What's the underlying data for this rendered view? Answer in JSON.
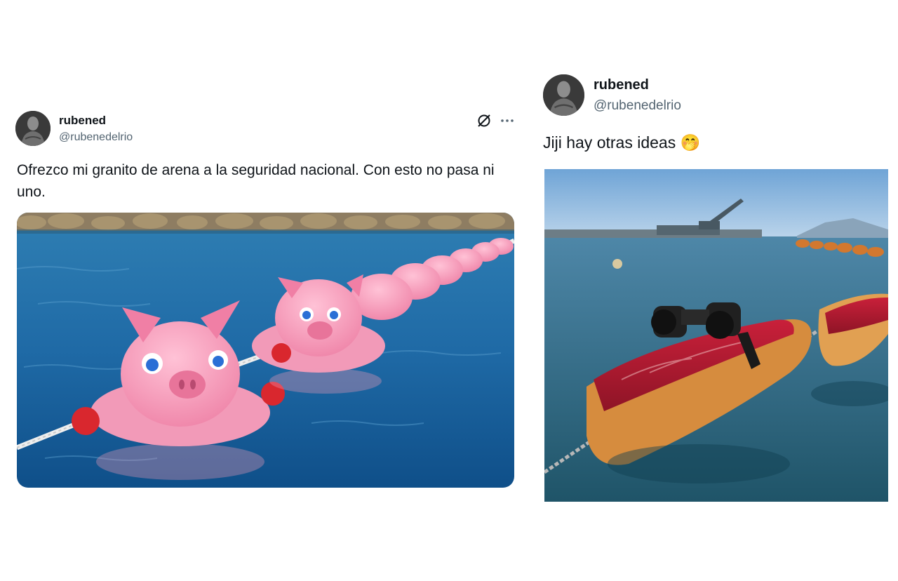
{
  "tweet_left": {
    "display_name": "rubened",
    "handle": "@rubenedelrio",
    "text": "Ofrezco mi granito de arena a la seguridad nacional. Con esto no pasa ni uno.",
    "icons": [
      "grok-icon",
      "more-options-icon"
    ],
    "media": "pig-buoys-photo"
  },
  "tweet_right": {
    "display_name": "rubened",
    "handle": "@rubenedelrio",
    "text": "Jiji hay otras ideas",
    "emoji": "🤭",
    "media": "ham-buoys-photo"
  }
}
